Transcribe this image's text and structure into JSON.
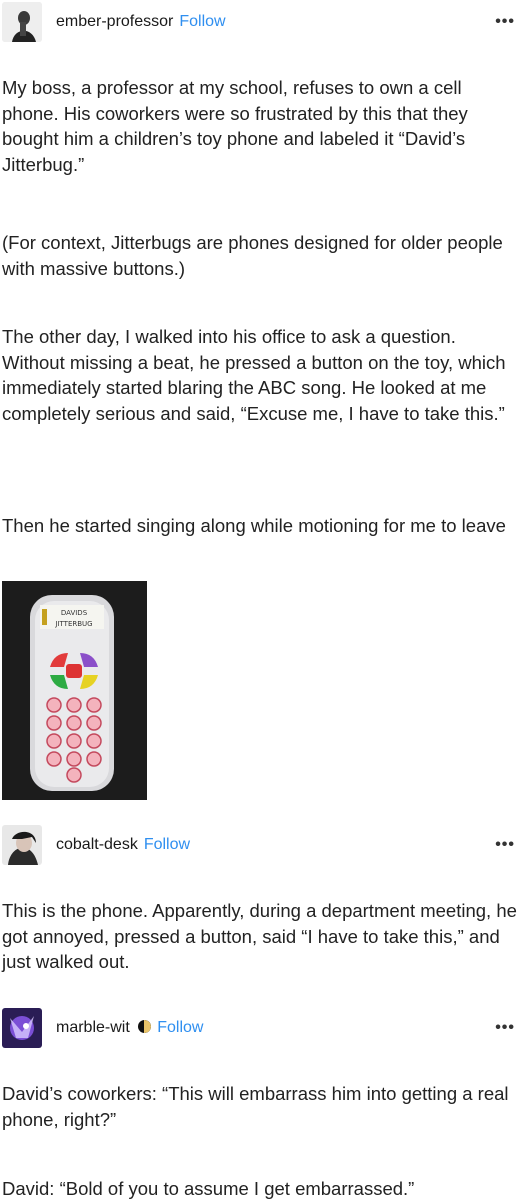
{
  "posts": [
    {
      "username": "ember-professor",
      "follow": "Follow",
      "more": "•••",
      "paragraphs": [
        "My boss, a professor at my school, refuses to own a cell phone. His coworkers were so frustrated by this that they bought him a children’s toy phone and labeled it “David’s Jitterbug.”",
        "(For context, Jitterbugs are phones designed for older people with massive buttons.)",
        "The other day, I walked into his office to ask a question. Without missing a beat, he pressed a button on the toy, which immediately started blaring the ABC song. He looked at me completely serious and said, “Excuse me, I have to take this.”",
        "Then he started singing along while motioning for me to leave"
      ],
      "photo_label": "DAVIDS\nJITTERBUG"
    },
    {
      "username": "cobalt-desk",
      "follow": "Follow",
      "more": "•••",
      "paragraphs": [
        "This is the phone. Apparently, during a department meeting, he got annoyed, pressed a button, said “I have to take this,” and just walked out."
      ]
    },
    {
      "username": "marble-wit",
      "follow": "Follow",
      "more": "•••",
      "paragraphs": [
        "David’s coworkers: “This will embarrass him into getting a real phone, right?”",
        "David: “Bold of you to assume I get embarrassed.”"
      ]
    }
  ],
  "colors": {
    "follow": "#2f8ff0",
    "text": "#222222"
  }
}
